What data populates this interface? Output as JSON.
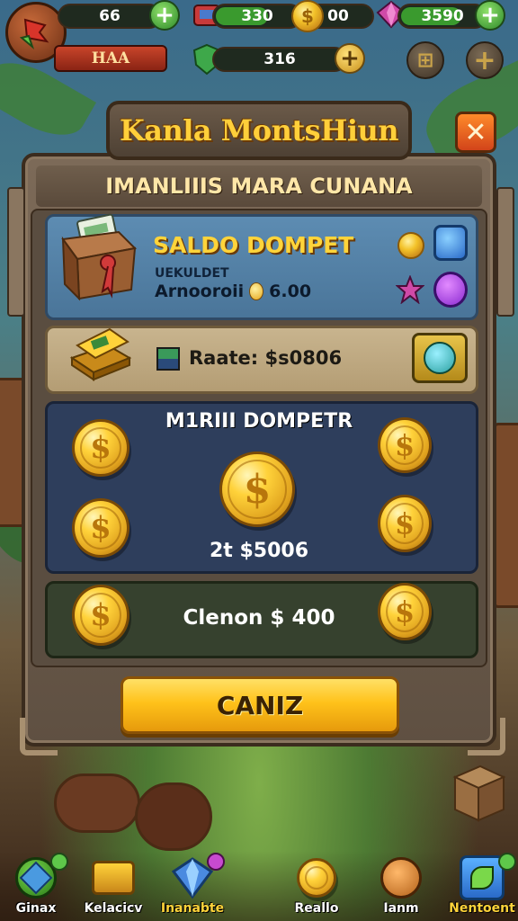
{
  "hud": {
    "gems": "66",
    "energy": "330",
    "coins": "00",
    "crystals": "3590",
    "player_name": "HAA",
    "shield": "316"
  },
  "popup": {
    "title": "Kanla MontsHiun",
    "subtitle": "IMANLIIIS MARA CUNANA",
    "wallet": {
      "title": "SALDO DOMPET",
      "label": "UEKULDET",
      "amount_label": "Arnooroii",
      "amount": "6.00"
    },
    "rate": {
      "text": "Raate: $s0806"
    },
    "coins_section": {
      "title": "M1RIII DOMPETR",
      "total": "2t $5006",
      "coin_symbol": "$"
    },
    "claim": {
      "text": "Clenon $ 400"
    },
    "confirm_label": "CANIZ",
    "close_icon": "close-icon"
  },
  "nav": [
    {
      "label": "Ginax",
      "icon": "cube-icon"
    },
    {
      "label": "Kelacicv",
      "icon": "gold-bars-icon"
    },
    {
      "label": "Inanabte",
      "icon": "crystal-icon"
    },
    {
      "label": "Reallo",
      "icon": "coin-stack-icon"
    },
    {
      "label": "Ianm",
      "icon": "medal-icon"
    },
    {
      "label": "Nentoent",
      "icon": "map-icon"
    }
  ],
  "colors": {
    "accent_gold": "#ffc21a",
    "title_gold": "#ffcf3a",
    "close_orange": "#ff8a2a",
    "plus_green": "#2e8a2a",
    "panel_brown": "#6b5a49"
  }
}
